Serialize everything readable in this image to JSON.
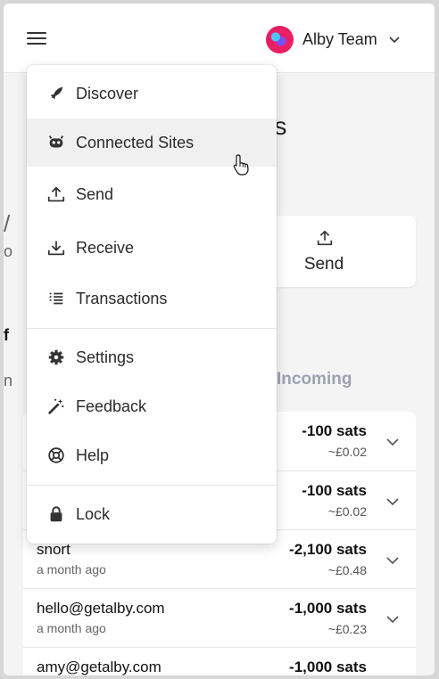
{
  "header": {
    "account_name": "Alby Team"
  },
  "background": {
    "title_fragment": "nts",
    "send_label": "Send",
    "tab_incoming": "Incoming",
    "edge_glyphs": [
      "/",
      "o",
      "f",
      "n"
    ]
  },
  "menu": {
    "items": [
      {
        "label": "Discover",
        "icon": "rocket-icon"
      },
      {
        "label": "Connected Sites",
        "icon": "robot-icon"
      },
      {
        "label": "Send",
        "icon": "upload-icon"
      },
      {
        "label": "Receive",
        "icon": "download-icon"
      },
      {
        "label": "Transactions",
        "icon": "list-icon"
      },
      {
        "label": "Settings",
        "icon": "gear-icon"
      },
      {
        "label": "Feedback",
        "icon": "magic-wand-icon"
      },
      {
        "label": "Help",
        "icon": "lifebuoy-icon"
      },
      {
        "label": "Lock",
        "icon": "lock-icon"
      }
    ],
    "hovered_item": "Connected Sites"
  },
  "transactions": [
    {
      "name": "",
      "time": "",
      "amount": "-100 sats",
      "fiat": "~£0.02"
    },
    {
      "name": "",
      "time": "",
      "amount": "-100 sats",
      "fiat": "~£0.02"
    },
    {
      "name": "snort",
      "time": "a month ago",
      "amount": "-2,100 sats",
      "fiat": "~£0.48"
    },
    {
      "name": "hello@getalby.com",
      "time": "a month ago",
      "amount": "-1,000 sats",
      "fiat": "~£0.23"
    },
    {
      "name": "amy@getalby.com",
      "time": "",
      "amount": "-1,000 sats",
      "fiat": ""
    }
  ],
  "colors": {
    "accent": "#7c3aed",
    "menu_hover": "#f0f0f0",
    "incoming_tab": "#9ca3af"
  }
}
